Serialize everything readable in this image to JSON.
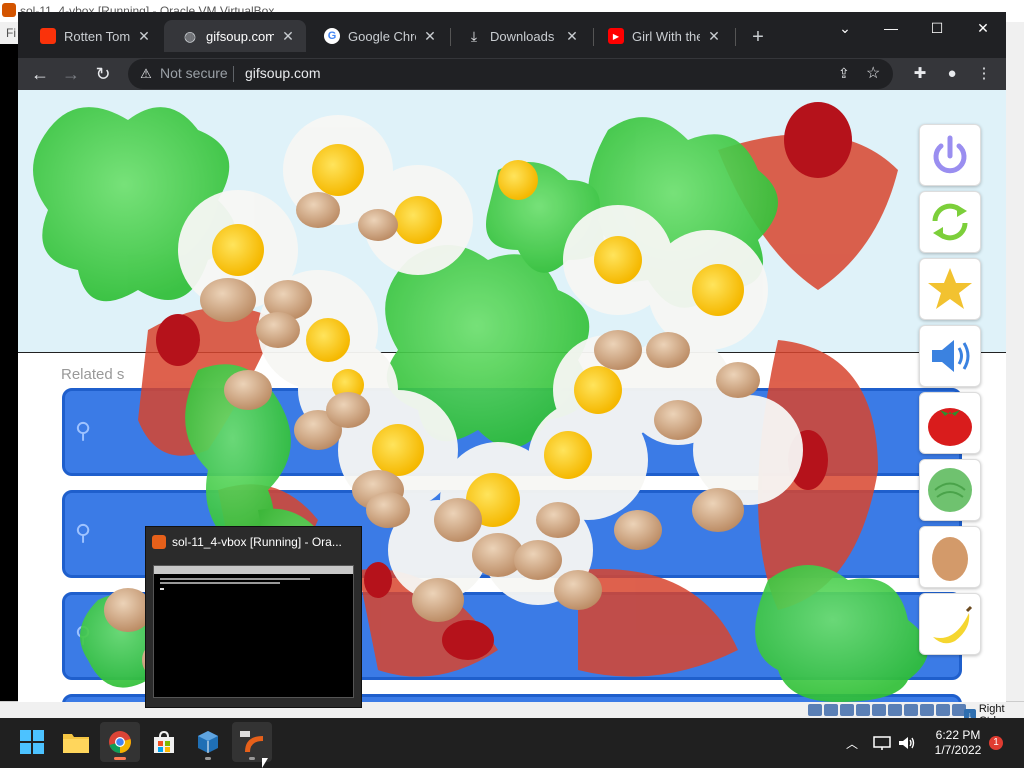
{
  "host": {
    "title": "sol-11_4-vbox [Running] - Oracle VM VirtualBox",
    "menu_first": "Fi",
    "host_key": "Right Ctrl"
  },
  "browser": {
    "tabs": [
      {
        "label": "Rotten Tomatoes",
        "icon": "rotten-tomatoes-favicon"
      },
      {
        "label": "gifsoup.com",
        "icon": "globe-icon"
      },
      {
        "label": "Google Chrome",
        "icon": "google-favicon"
      },
      {
        "label": "Downloads",
        "icon": "download-icon"
      },
      {
        "label": "Girl With the n",
        "icon": "youtube-favicon"
      }
    ],
    "security_label": "Not secure",
    "url": "gifsoup.com"
  },
  "page": {
    "related_label": "Related s"
  },
  "thumbnail": {
    "title": "sol-11_4-vbox [Running] - Ora..."
  },
  "taskbar": {
    "time": "6:22 PM",
    "date": "1/7/2022",
    "notifications": "1"
  },
  "colors": {
    "chrome_dark": "#202124",
    "chrome_toolbar": "#35363a",
    "result_blue": "#3b7be6",
    "page_sky": "#dff2f9",
    "splat_green": "#3ec93e"
  }
}
